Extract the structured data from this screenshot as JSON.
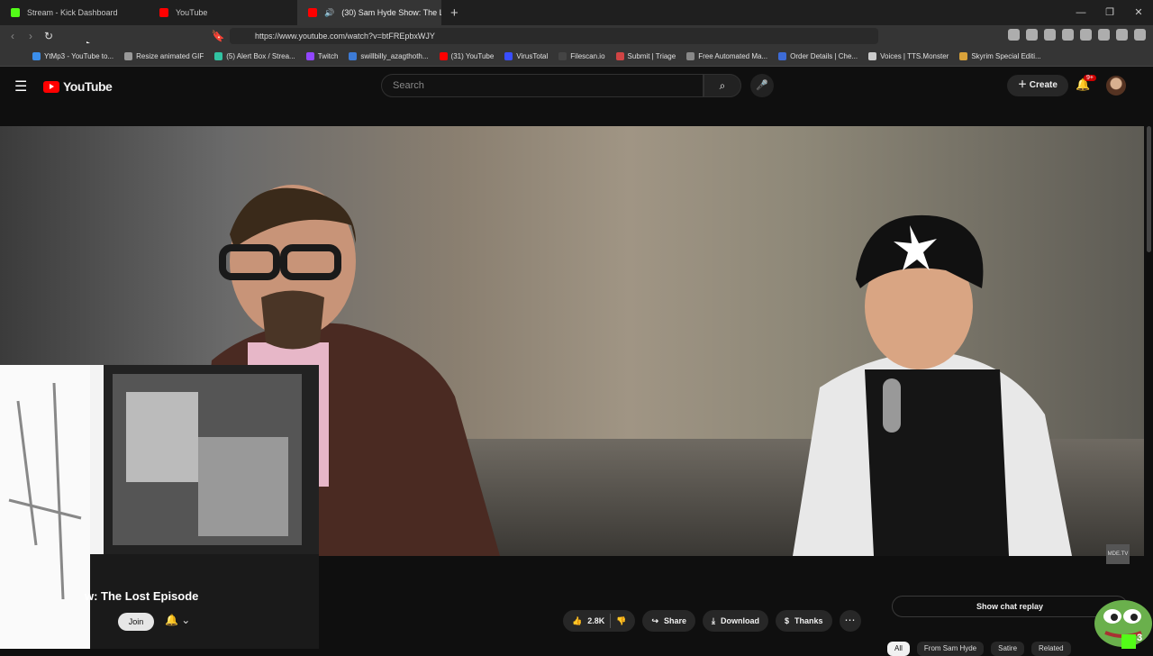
{
  "browser": {
    "tabs": [
      {
        "title": "Stream - Kick Dashboard",
        "icon": "kick-icon",
        "color": "#53fc18"
      },
      {
        "title": "YouTube",
        "icon": "youtube-icon",
        "color": "#ff0000"
      },
      {
        "title": "(30) Sam Hyde Show: The Lo",
        "icon": "youtube-icon",
        "color": "#ff0000"
      }
    ],
    "url": "https://www.youtube.com/watch?v=btFREpbxWJY",
    "bookmarks": [
      {
        "label": "YtMp3 - YouTube to...",
        "color": "#3b8eea"
      },
      {
        "label": "Resize animated GIF",
        "color": "#999999"
      },
      {
        "label": "(5) Alert Box / Strea...",
        "color": "#31c3a2"
      },
      {
        "label": "Twitch",
        "color": "#9146ff"
      },
      {
        "label": "swillbilly_azagthoth...",
        "color": "#3d7bd6"
      },
      {
        "label": "(31) YouTube",
        "color": "#ff0000"
      },
      {
        "label": "VirusTotal",
        "color": "#394eff"
      },
      {
        "label": "Filescan.io",
        "color": "#444444"
      },
      {
        "label": "Submit | Triage",
        "color": "#d04444"
      },
      {
        "label": "Free Automated Ma...",
        "color": "#888888"
      },
      {
        "label": "Order Details | Che...",
        "color": "#3d6bd6"
      },
      {
        "label": "Voices | TTS.Monster",
        "color": "#cccccc"
      },
      {
        "label": "Skyrim Special Editi...",
        "color": "#d9a23a"
      }
    ]
  },
  "youtube": {
    "logo": "YouTube",
    "search_placeholder": "Search",
    "create_label": "Create",
    "notif_badge": "9+",
    "video_title": "w: The Lost Episode",
    "join_label": "Join",
    "likes": "2.8K",
    "share_label": "Share",
    "download_label": "Download",
    "thanks_label": "Thanks",
    "chat_replay_label": "Show chat replay",
    "watermark": "MDE.TV",
    "chips": [
      "All",
      "From Sam Hyde",
      "Satire",
      "Related"
    ],
    "overlay_count": "3"
  }
}
